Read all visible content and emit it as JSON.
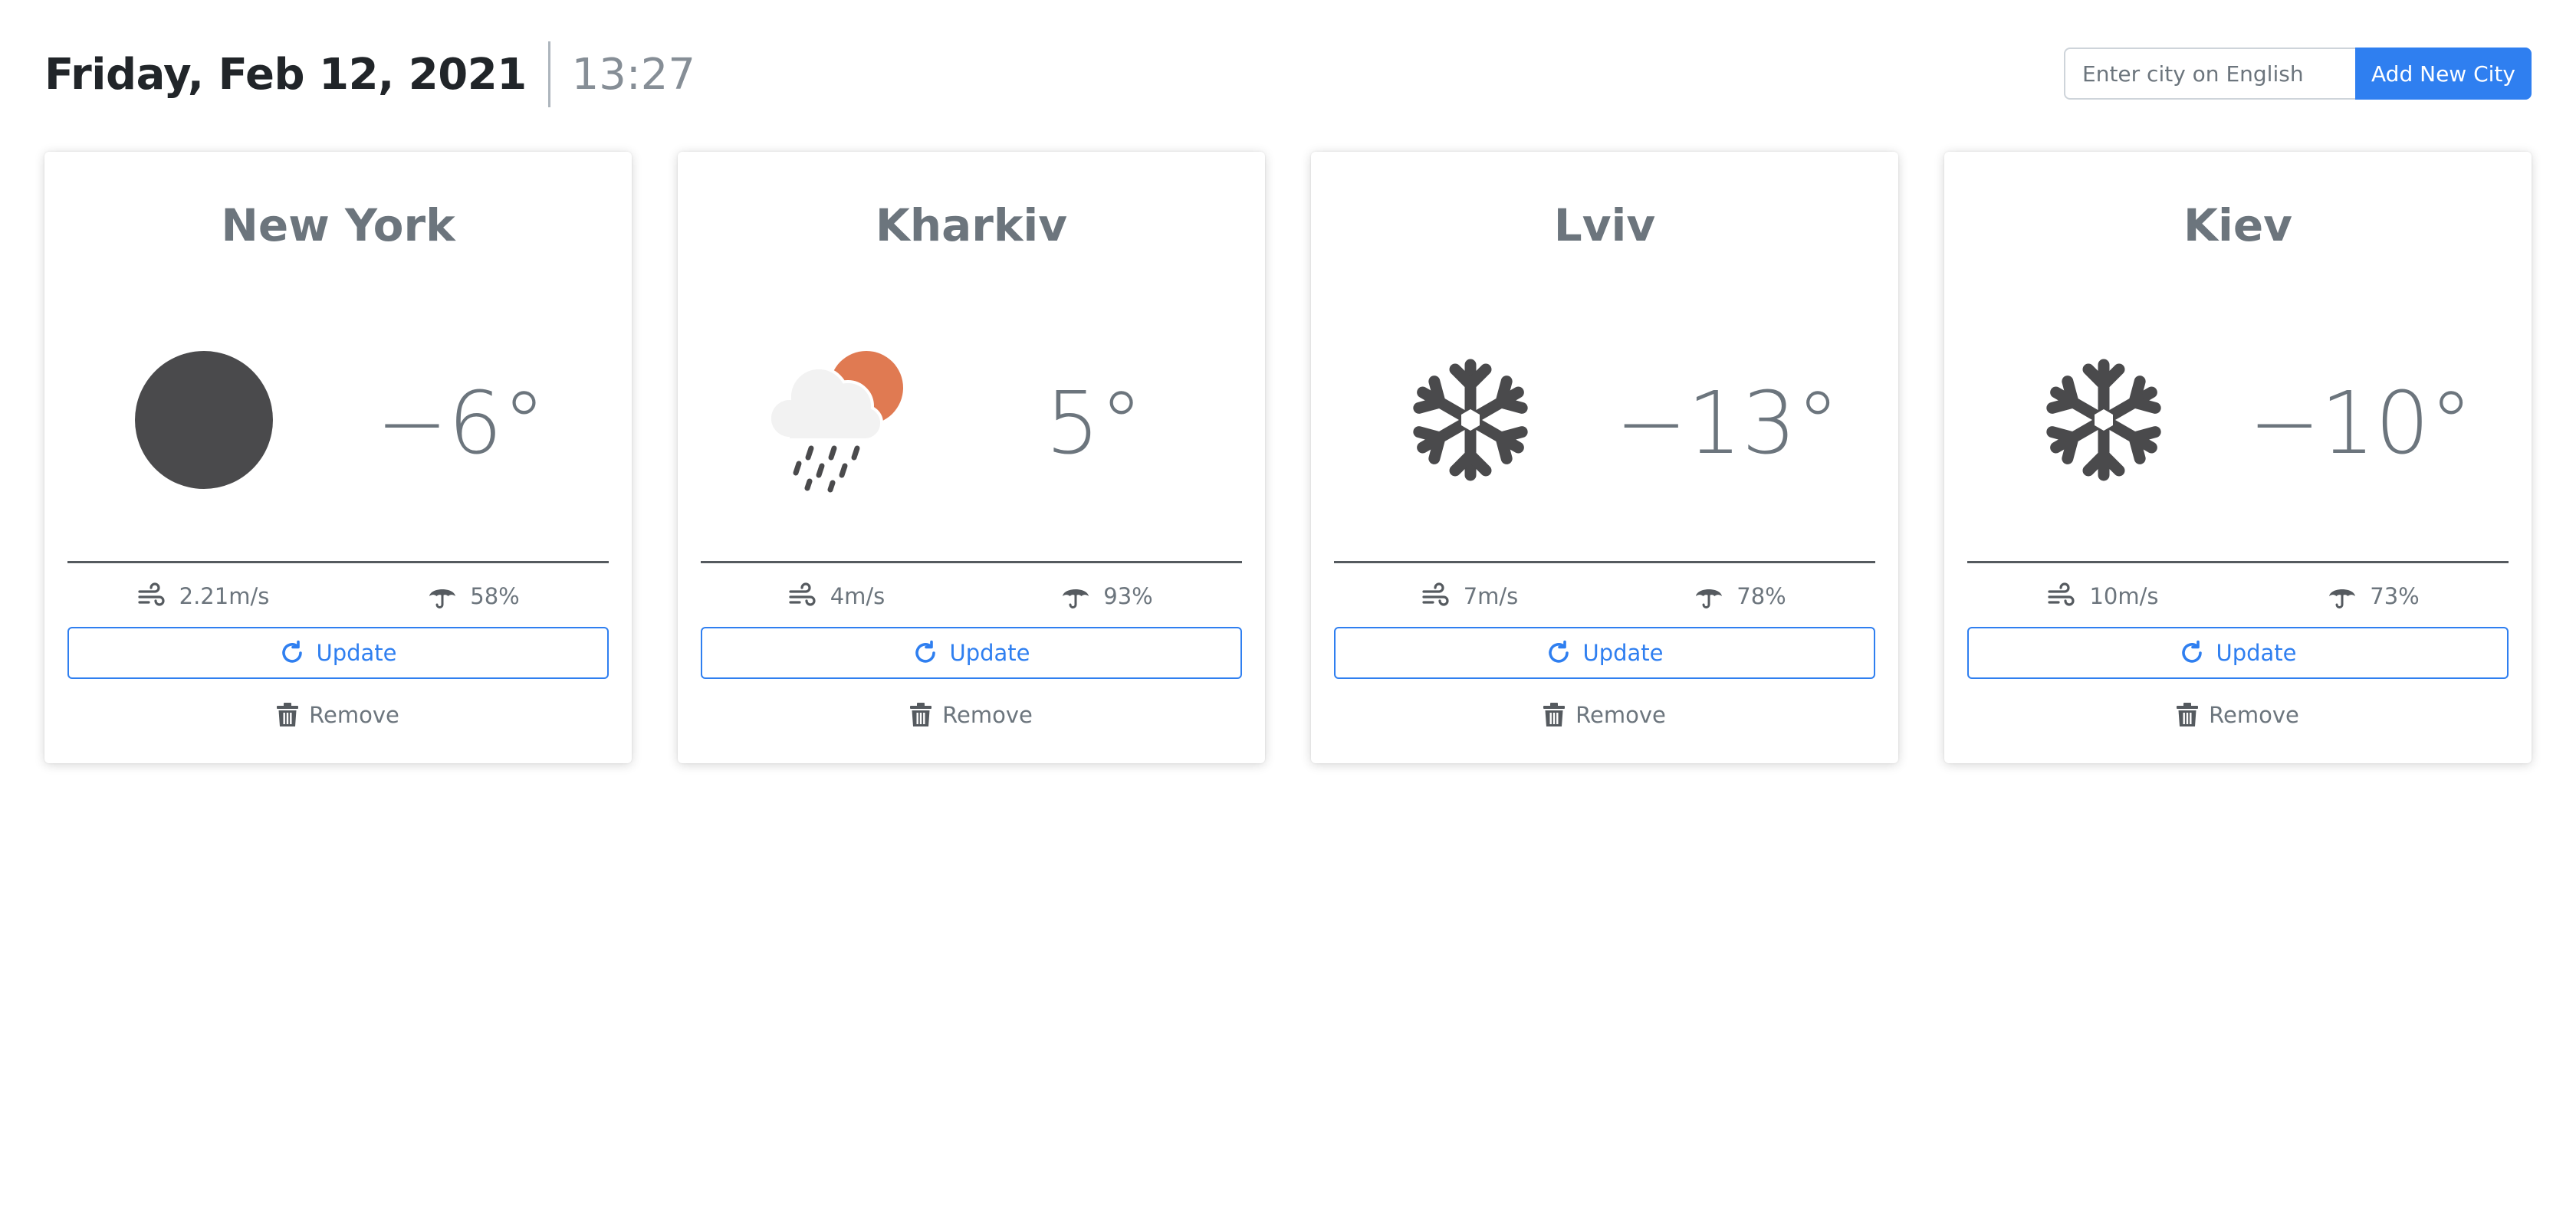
{
  "header": {
    "date": "Friday, Feb 12, 2021",
    "time": "13:27"
  },
  "add_city": {
    "placeholder": "Enter city on English",
    "button_label": "Add New City"
  },
  "colors": {
    "accent": "#2f7ff0",
    "icon_dark": "#4a4a4c",
    "sun": "#e07a52",
    "cloud": "#f2f2f2"
  },
  "cards": [
    {
      "city": "New York",
      "icon": "moon-icon",
      "temperature": "−6°",
      "wind": "2.21m/s",
      "humidity": "58%",
      "update_label": "Update",
      "remove_label": "Remove"
    },
    {
      "city": "Kharkiv",
      "icon": "sun-cloud-rain-icon",
      "temperature": "5°",
      "wind": "4m/s",
      "humidity": "93%",
      "update_label": "Update",
      "remove_label": "Remove"
    },
    {
      "city": "Lviv",
      "icon": "snowflake-icon",
      "temperature": "−13°",
      "wind": "7m/s",
      "humidity": "78%",
      "update_label": "Update",
      "remove_label": "Remove"
    },
    {
      "city": "Kiev",
      "icon": "snowflake-icon",
      "temperature": "−10°",
      "wind": "10m/s",
      "humidity": "73%",
      "update_label": "Update",
      "remove_label": "Remove"
    }
  ]
}
